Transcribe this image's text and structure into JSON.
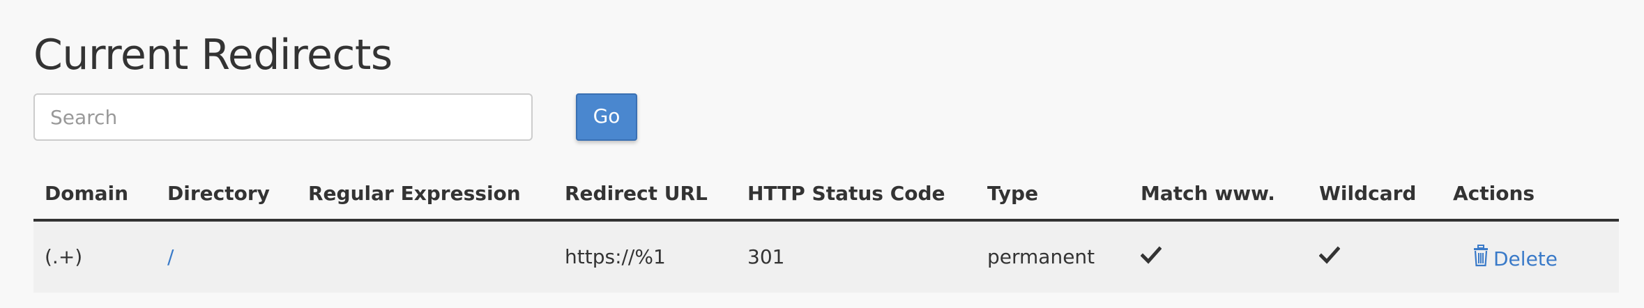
{
  "page": {
    "title": "Current Redirects"
  },
  "search": {
    "placeholder": "Search",
    "value": "",
    "go_label": "Go"
  },
  "table": {
    "columns": [
      "Domain",
      "Directory",
      "Regular Expression",
      "Redirect URL",
      "HTTP Status Code",
      "Type",
      "Match www.",
      "Wildcard",
      "Actions"
    ],
    "rows": [
      {
        "domain": "(.+)",
        "directory": "/",
        "regex": "",
        "redirect_url": "https://%1",
        "status_code": "301",
        "type": "permanent",
        "match_www": true,
        "wildcard": true,
        "action_label": "Delete"
      }
    ]
  },
  "icons": {
    "check": "checkmark-icon",
    "delete": "trash-icon"
  },
  "colors": {
    "background": "#f8f8f8",
    "row_background": "#f0f0f0",
    "primary_button": "#4a87cf",
    "link": "#3a7ac8",
    "text": "#333333"
  }
}
